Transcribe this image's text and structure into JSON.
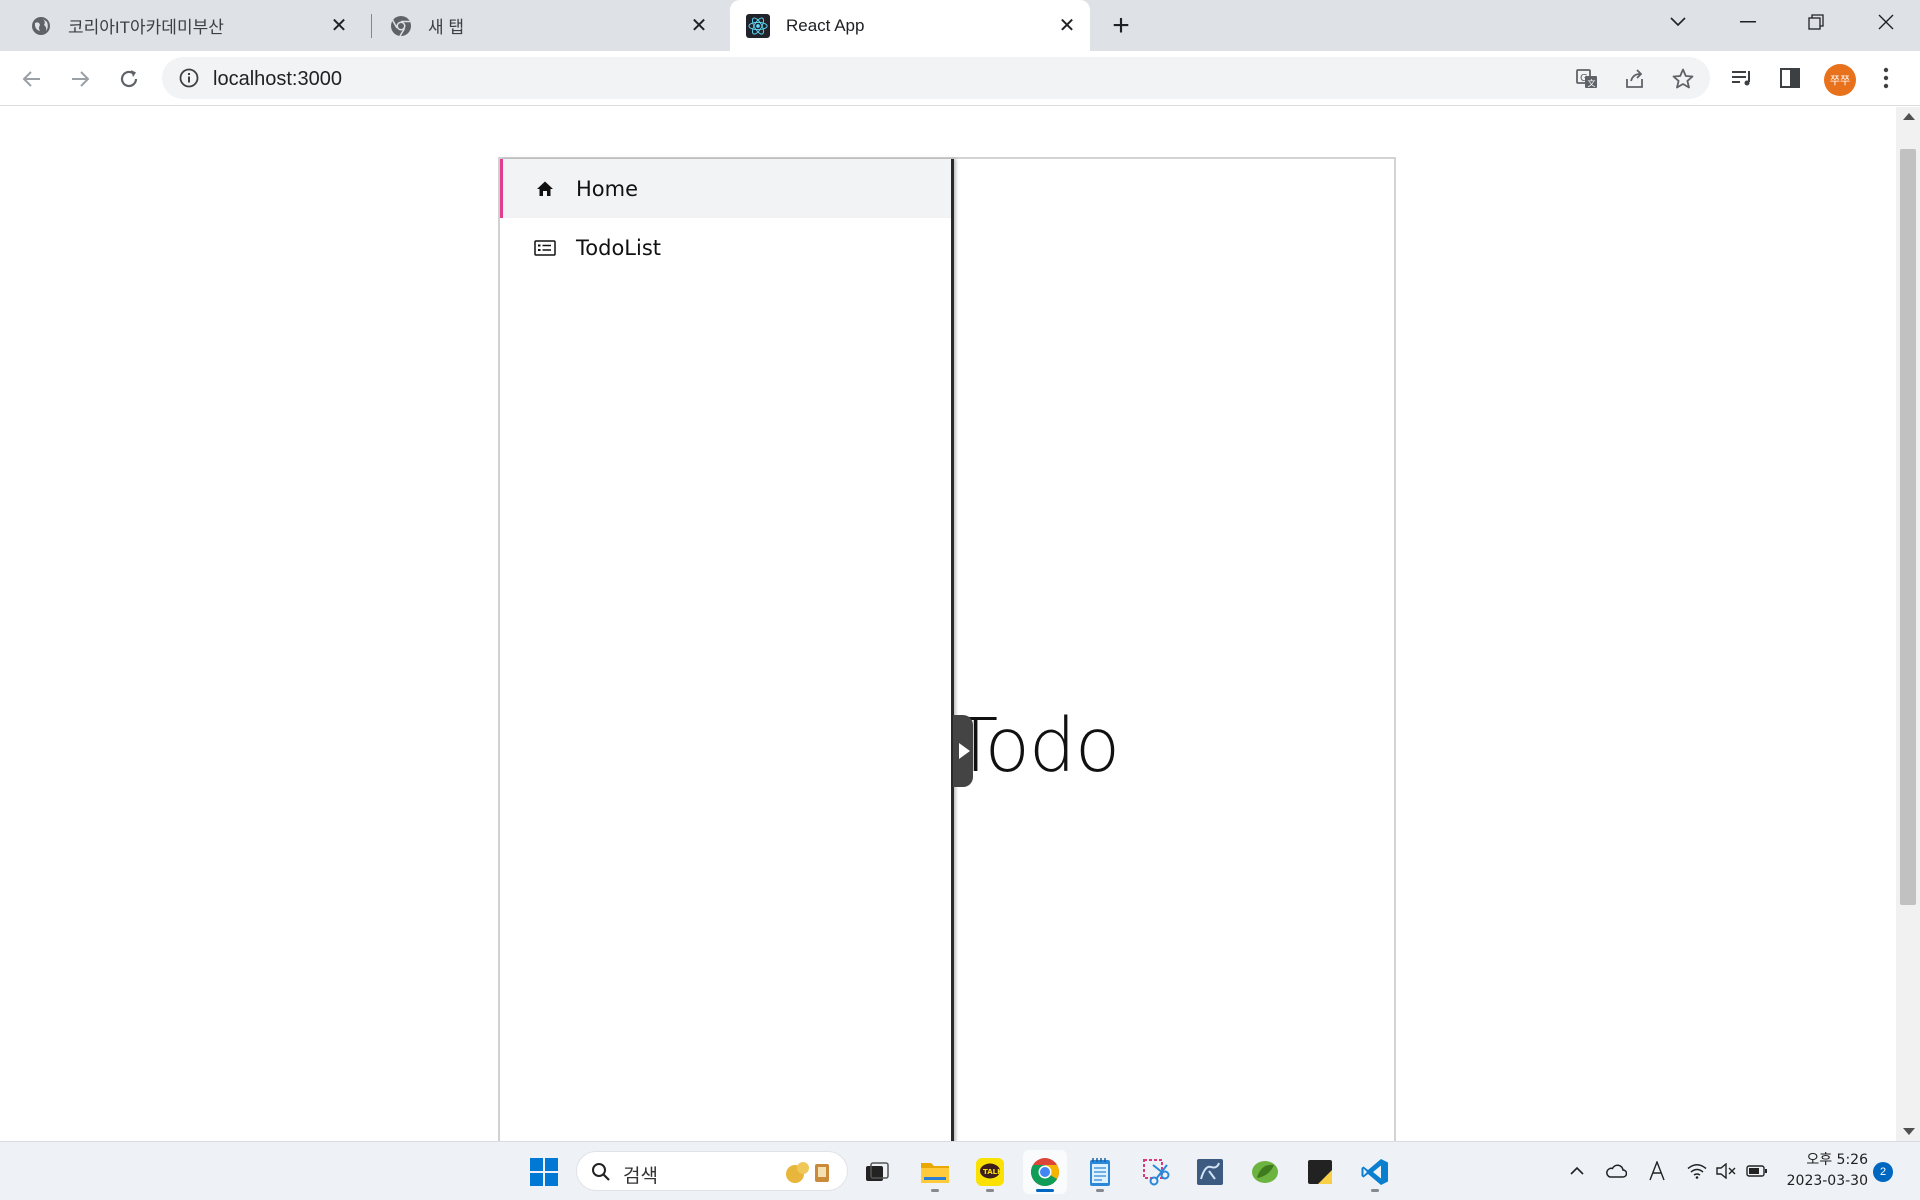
{
  "browser": {
    "tabs": [
      {
        "title": "코리아IT아카데미부산",
        "favicon": "globe-icon",
        "active": false
      },
      {
        "title": "새 탭",
        "favicon": "chrome-icon",
        "active": false
      },
      {
        "title": "React App",
        "favicon": "react-icon",
        "active": true
      }
    ],
    "address": "localhost:3000",
    "profile_initials": "쭈쭈",
    "colors": {
      "tabstrip": "#dee1e6",
      "profile": "#e8711c"
    }
  },
  "app": {
    "sidebar": {
      "items": [
        {
          "label": "Home",
          "icon": "home-icon",
          "selected": true
        },
        {
          "label": "TodoList",
          "icon": "list-icon",
          "selected": false
        }
      ],
      "accent_color": "#e23e8f"
    },
    "content": {
      "heading": "Todo"
    }
  },
  "taskbar": {
    "search_placeholder": "검색",
    "apps": [
      "windows-start-icon",
      "task-view-icon",
      "file-explorer-icon",
      "kakaotalk-icon",
      "chrome-icon",
      "notepad-icon",
      "snipping-tool-icon",
      "mysql-workbench-icon",
      "spring-tool-icon",
      "sticky-notes-icon",
      "vscode-icon"
    ],
    "time": "오후 5:26",
    "date": "2023-03-30",
    "notification_count": "2"
  }
}
